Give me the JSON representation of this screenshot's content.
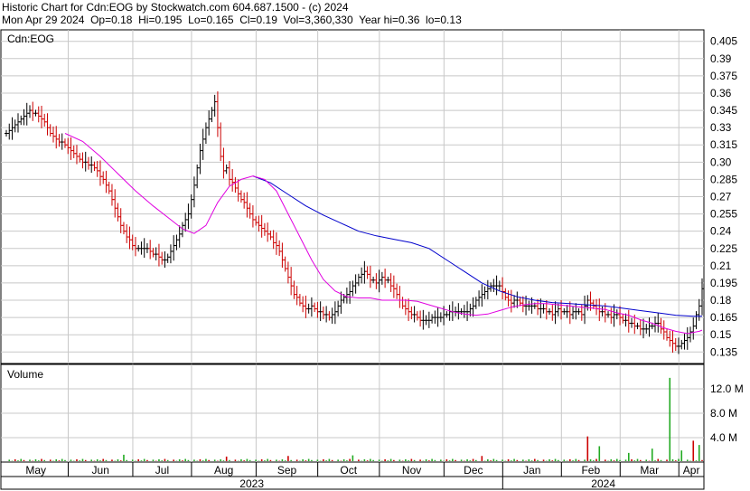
{
  "header": {
    "line1": "Historic Chart for Cdn:EOG by Stockwatch.com 604.687.1500 - (c) 2024",
    "line2": "Mon Apr 29 2024  Op=0.18  Hi=0.195  Lo=0.165  Cl=0.19  Vol=3,360,330  Year hi=0.36  lo=0.13"
  },
  "chart_data": {
    "type": "ohlc",
    "symbol": "Cdn:EOG",
    "price_axis": {
      "ylim": [
        0.125,
        0.415
      ],
      "ticks": [
        "0.405",
        "0.39",
        "0.375",
        "0.36",
        "0.345",
        "0.33",
        "0.315",
        "0.30",
        "0.285",
        "0.27",
        "0.255",
        "0.24",
        "0.225",
        "0.21",
        "0.195",
        "0.18",
        "0.165",
        "0.15",
        "0.135"
      ]
    },
    "volume_panel": {
      "title": "Volume",
      "ylim": [
        0,
        16
      ],
      "ticks": [
        "12.0 M",
        "8.0 M",
        "4.0 M"
      ]
    },
    "months": [
      "May",
      "Jun",
      "Jul",
      "Aug",
      "Sep",
      "Oct",
      "Nov",
      "Dec",
      "Jan",
      "Feb",
      "Mar",
      "Apr"
    ],
    "years": [
      "2023",
      "2024"
    ],
    "grid": true,
    "colors": {
      "up": "#000000",
      "down": "#cc0000",
      "ma_short": "#e000e0",
      "ma_long": "#0000cc",
      "vol_up": "#22aa22",
      "vol_down": "#cc0000",
      "grid": "#c8c8c8"
    },
    "price_points": [
      [
        0,
        0.325
      ],
      [
        2,
        0.33
      ],
      [
        4,
        0.336
      ],
      [
        6,
        0.34
      ],
      [
        8,
        0.345
      ],
      [
        10,
        0.342
      ],
      [
        12,
        0.338
      ],
      [
        14,
        0.33
      ],
      [
        16,
        0.322
      ],
      [
        18,
        0.318
      ],
      [
        20,
        0.315
      ],
      [
        22,
        0.31
      ],
      [
        24,
        0.305
      ],
      [
        26,
        0.3
      ],
      [
        28,
        0.298
      ],
      [
        30,
        0.295
      ],
      [
        32,
        0.288
      ],
      [
        34,
        0.28
      ],
      [
        36,
        0.268
      ],
      [
        38,
        0.252
      ],
      [
        40,
        0.24
      ],
      [
        42,
        0.232
      ],
      [
        44,
        0.225
      ],
      [
        46,
        0.226
      ],
      [
        48,
        0.224
      ],
      [
        50,
        0.22
      ],
      [
        52,
        0.218
      ],
      [
        54,
        0.214
      ],
      [
        56,
        0.222
      ],
      [
        58,
        0.232
      ],
      [
        60,
        0.245
      ],
      [
        62,
        0.255
      ],
      [
        64,
        0.28
      ],
      [
        66,
        0.31
      ],
      [
        68,
        0.33
      ],
      [
        70,
        0.345
      ],
      [
        71,
        0.352
      ],
      [
        72,
        0.33
      ],
      [
        73,
        0.305
      ],
      [
        74,
        0.292
      ],
      [
        75,
        0.296
      ],
      [
        76,
        0.285
      ],
      [
        78,
        0.278
      ],
      [
        80,
        0.268
      ],
      [
        82,
        0.26
      ],
      [
        84,
        0.25
      ],
      [
        86,
        0.245
      ],
      [
        88,
        0.24
      ],
      [
        90,
        0.234
      ],
      [
        92,
        0.228
      ],
      [
        94,
        0.215
      ],
      [
        96,
        0.2
      ],
      [
        98,
        0.185
      ],
      [
        100,
        0.178
      ],
      [
        102,
        0.172
      ],
      [
        104,
        0.175
      ],
      [
        106,
        0.17
      ],
      [
        108,
        0.168
      ],
      [
        110,
        0.166
      ],
      [
        112,
        0.17
      ],
      [
        114,
        0.18
      ],
      [
        116,
        0.185
      ],
      [
        118,
        0.192
      ],
      [
        120,
        0.2
      ],
      [
        122,
        0.205
      ],
      [
        124,
        0.198
      ],
      [
        126,
        0.195
      ],
      [
        128,
        0.2
      ],
      [
        130,
        0.197
      ],
      [
        132,
        0.19
      ],
      [
        134,
        0.18
      ],
      [
        136,
        0.172
      ],
      [
        138,
        0.168
      ],
      [
        140,
        0.165
      ],
      [
        142,
        0.162
      ],
      [
        144,
        0.163
      ],
      [
        146,
        0.165
      ],
      [
        148,
        0.166
      ],
      [
        150,
        0.168
      ],
      [
        152,
        0.17
      ],
      [
        154,
        0.169
      ],
      [
        156,
        0.17
      ],
      [
        158,
        0.172
      ],
      [
        160,
        0.18
      ],
      [
        162,
        0.185
      ],
      [
        164,
        0.19
      ],
      [
        166,
        0.193
      ],
      [
        168,
        0.192
      ],
      [
        170,
        0.182
      ],
      [
        172,
        0.178
      ],
      [
        174,
        0.18
      ],
      [
        176,
        0.176
      ],
      [
        178,
        0.175
      ],
      [
        180,
        0.174
      ],
      [
        182,
        0.173
      ],
      [
        184,
        0.17
      ],
      [
        186,
        0.168
      ],
      [
        188,
        0.172
      ],
      [
        190,
        0.17
      ],
      [
        192,
        0.168
      ],
      [
        194,
        0.17
      ],
      [
        196,
        0.168
      ],
      [
        198,
        0.18
      ],
      [
        200,
        0.174
      ],
      [
        202,
        0.17
      ],
      [
        204,
        0.168
      ],
      [
        206,
        0.165
      ],
      [
        208,
        0.168
      ],
      [
        210,
        0.163
      ],
      [
        212,
        0.16
      ],
      [
        214,
        0.158
      ],
      [
        216,
        0.156
      ],
      [
        218,
        0.155
      ],
      [
        220,
        0.158
      ],
      [
        222,
        0.16
      ],
      [
        224,
        0.152
      ],
      [
        226,
        0.145
      ],
      [
        228,
        0.14
      ],
      [
        230,
        0.142
      ],
      [
        232,
        0.148
      ],
      [
        234,
        0.158
      ],
      [
        236,
        0.175
      ],
      [
        237,
        0.19
      ]
    ],
    "ma_short_points": [
      [
        20,
        0.325
      ],
      [
        26,
        0.318
      ],
      [
        32,
        0.305
      ],
      [
        38,
        0.29
      ],
      [
        44,
        0.275
      ],
      [
        50,
        0.262
      ],
      [
        56,
        0.25
      ],
      [
        60,
        0.242
      ],
      [
        64,
        0.238
      ],
      [
        68,
        0.245
      ],
      [
        72,
        0.265
      ],
      [
        76,
        0.279
      ],
      [
        80,
        0.285
      ],
      [
        84,
        0.288
      ],
      [
        88,
        0.285
      ],
      [
        92,
        0.275
      ],
      [
        96,
        0.255
      ],
      [
        100,
        0.235
      ],
      [
        104,
        0.215
      ],
      [
        108,
        0.198
      ],
      [
        112,
        0.188
      ],
      [
        116,
        0.183
      ],
      [
        120,
        0.182
      ],
      [
        124,
        0.182
      ],
      [
        128,
        0.18
      ],
      [
        132,
        0.18
      ],
      [
        136,
        0.18
      ],
      [
        140,
        0.179
      ],
      [
        144,
        0.176
      ],
      [
        148,
        0.173
      ],
      [
        152,
        0.17
      ],
      [
        156,
        0.168
      ],
      [
        160,
        0.167
      ],
      [
        164,
        0.168
      ],
      [
        168,
        0.171
      ],
      [
        172,
        0.174
      ],
      [
        176,
        0.176
      ],
      [
        180,
        0.177
      ],
      [
        184,
        0.177
      ],
      [
        188,
        0.176
      ],
      [
        192,
        0.175
      ],
      [
        196,
        0.174
      ],
      [
        200,
        0.173
      ],
      [
        204,
        0.172
      ],
      [
        208,
        0.169
      ],
      [
        212,
        0.167
      ],
      [
        216,
        0.163
      ],
      [
        220,
        0.16
      ],
      [
        224,
        0.156
      ],
      [
        228,
        0.153
      ],
      [
        232,
        0.151
      ],
      [
        236,
        0.153
      ],
      [
        237,
        0.154
      ]
    ],
    "ma_long_points": [
      [
        84,
        0.288
      ],
      [
        90,
        0.282
      ],
      [
        96,
        0.272
      ],
      [
        102,
        0.262
      ],
      [
        108,
        0.254
      ],
      [
        114,
        0.247
      ],
      [
        120,
        0.24
      ],
      [
        126,
        0.236
      ],
      [
        132,
        0.233
      ],
      [
        138,
        0.23
      ],
      [
        144,
        0.225
      ],
      [
        150,
        0.215
      ],
      [
        156,
        0.205
      ],
      [
        162,
        0.195
      ],
      [
        168,
        0.188
      ],
      [
        174,
        0.183
      ],
      [
        180,
        0.18
      ],
      [
        186,
        0.178
      ],
      [
        192,
        0.177
      ],
      [
        198,
        0.176
      ],
      [
        204,
        0.175
      ],
      [
        210,
        0.173
      ],
      [
        216,
        0.171
      ],
      [
        222,
        0.169
      ],
      [
        228,
        0.167
      ],
      [
        234,
        0.166
      ],
      [
        237,
        0.166
      ]
    ],
    "volume_spikes": [
      [
        40,
        1.2
      ],
      [
        75,
        0.9
      ],
      [
        96,
        1.0
      ],
      [
        118,
        1.1
      ],
      [
        162,
        1.0
      ],
      [
        198,
        4.2
      ],
      [
        202,
        2.6
      ],
      [
        212,
        1.5
      ],
      [
        220,
        2.2
      ],
      [
        226,
        13.8
      ],
      [
        230,
        1.9
      ],
      [
        234,
        3.5
      ],
      [
        236,
        2.8
      ]
    ]
  }
}
